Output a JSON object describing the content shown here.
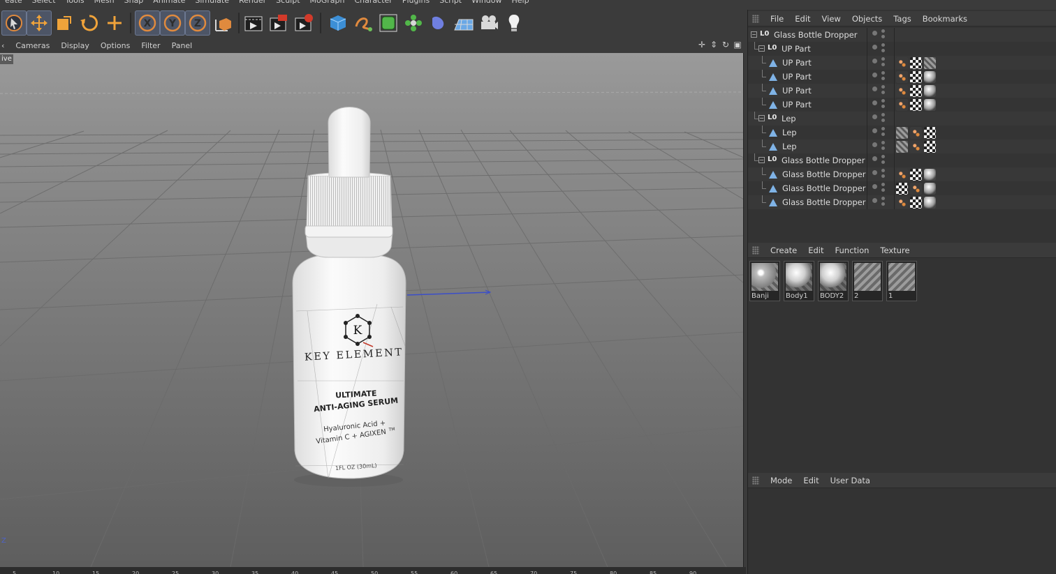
{
  "menubar": [
    "eate",
    "Select",
    "Tools",
    "Mesh",
    "Snap",
    "Animate",
    "Simulate",
    "Render",
    "Sculpt",
    "MoGraph",
    "Character",
    "Plugins",
    "Script",
    "Window",
    "Help"
  ],
  "toolbar": {
    "icons": [
      "live-selection-icon",
      "move-icon",
      "scale-icon",
      "rotate-icon",
      "add-object-icon",
      "x-axis-icon",
      "y-axis-icon",
      "z-axis-icon",
      "coordinate-system-icon",
      "render-view-icon",
      "render-picture-viewer-icon",
      "render-settings-icon",
      "cube-icon",
      "spline-pen-icon",
      "subdivision-icon",
      "mograph-cloner-icon",
      "deformer-icon",
      "floor-icon",
      "camera-icon",
      "light-icon"
    ],
    "axis_labels": [
      "X",
      "Y",
      "Z"
    ]
  },
  "viewport": {
    "menu": [
      "Cameras",
      "Display",
      "Options",
      "Filter",
      "Panel"
    ],
    "view_label": "ive",
    "axis_label": "Z",
    "bottle": {
      "brand": "KEY ELEMENT",
      "line1": "ULTIMATE",
      "line2": "ANTI-AGING SERUM",
      "line3": "Hyaluronic Acid +",
      "line4": "Vitamin C + AGIXEN",
      "tm": "TM",
      "volume": "1FL OZ (30mL)",
      "logo_letter": "K"
    }
  },
  "timeline": {
    "ticks": [
      "5",
      "10",
      "15",
      "20",
      "25",
      "30",
      "35",
      "40",
      "45",
      "50",
      "55",
      "60",
      "65",
      "70",
      "75",
      "80",
      "85",
      "90"
    ]
  },
  "objects_panel": {
    "menu": [
      "File",
      "Edit",
      "View",
      "Objects",
      "Tags",
      "Bookmarks"
    ],
    "rows": [
      {
        "name": "Glass Bottle Dropper",
        "type": "null",
        "level": 0,
        "expanded": true,
        "tags": []
      },
      {
        "name": "UP Part",
        "type": "null",
        "level": 1,
        "expanded": true,
        "tags": []
      },
      {
        "name": "UP Part",
        "type": "poly",
        "level": 2,
        "tags": [
          "phong",
          "uvw",
          "hatch"
        ]
      },
      {
        "name": "UP Part",
        "type": "poly",
        "level": 2,
        "tags": [
          "phong",
          "uvw",
          "mat"
        ]
      },
      {
        "name": "UP Part",
        "type": "poly",
        "level": 2,
        "tags": [
          "phong",
          "uvw",
          "mat"
        ]
      },
      {
        "name": "UP Part",
        "type": "poly",
        "level": 2,
        "tags": [
          "phong",
          "uvw",
          "mat"
        ]
      },
      {
        "name": "Lep",
        "type": "null",
        "level": 1,
        "expanded": true,
        "tags": []
      },
      {
        "name": "Lep",
        "type": "poly",
        "level": 2,
        "tags": [
          "hatch",
          "phong",
          "uvw"
        ]
      },
      {
        "name": "Lep",
        "type": "poly",
        "level": 2,
        "tags": [
          "hatch",
          "phong",
          "uvw"
        ]
      },
      {
        "name": "Glass Bottle Dropper",
        "type": "null",
        "level": 1,
        "expanded": true,
        "tags": []
      },
      {
        "name": "Glass Bottle Dropper",
        "type": "poly",
        "level": 2,
        "tags": [
          "phong",
          "uvw",
          "mat"
        ]
      },
      {
        "name": "Glass Bottle Dropper",
        "type": "poly",
        "level": 2,
        "tags": [
          "uvw",
          "phong",
          "mat"
        ]
      },
      {
        "name": "Glass Bottle Dropper",
        "type": "poly",
        "level": 2,
        "tags": [
          "phong",
          "uvw",
          "mat"
        ]
      }
    ]
  },
  "materials_panel": {
    "menu": [
      "Create",
      "Edit",
      "Function",
      "Texture"
    ],
    "materials": [
      {
        "name": "Banji",
        "style": "glass"
      },
      {
        "name": "Body1",
        "style": "white"
      },
      {
        "name": "BODY2",
        "style": "white"
      },
      {
        "name": "2",
        "style": "label"
      },
      {
        "name": "1",
        "style": "label"
      }
    ]
  },
  "attributes_panel": {
    "menu": [
      "Mode",
      "Edit",
      "User Data"
    ]
  }
}
